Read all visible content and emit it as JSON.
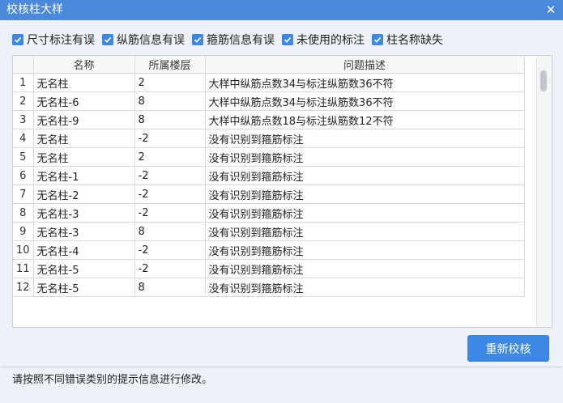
{
  "window": {
    "title": "校核柱大样",
    "close_icon": "close-icon"
  },
  "filters": [
    {
      "label": "尺寸标注有误",
      "checked": true
    },
    {
      "label": "纵筋信息有误",
      "checked": true
    },
    {
      "label": "箍筋信息有误",
      "checked": true
    },
    {
      "label": "未使用的标注",
      "checked": true
    },
    {
      "label": "柱名称缺失",
      "checked": true
    }
  ],
  "table": {
    "columns": [
      "",
      "名称",
      "所属楼层",
      "问题描述"
    ],
    "rows": [
      {
        "index": "1",
        "name": "无名柱",
        "floor": "2",
        "description": "大样中纵筋点数34与标注纵筋数36不符"
      },
      {
        "index": "2",
        "name": "无名柱-6",
        "floor": "8",
        "description": "大样中纵筋点数34与标注纵筋数36不符"
      },
      {
        "index": "3",
        "name": "无名柱-9",
        "floor": "8",
        "description": "大样中纵筋点数18与标注纵筋数12不符"
      },
      {
        "index": "4",
        "name": "无名柱",
        "floor": "-2",
        "description": "没有识别到箍筋标注"
      },
      {
        "index": "5",
        "name": "无名柱",
        "floor": "2",
        "description": "没有识别到箍筋标注"
      },
      {
        "index": "6",
        "name": "无名柱-1",
        "floor": "-2",
        "description": "没有识别到箍筋标注"
      },
      {
        "index": "7",
        "name": "无名柱-2",
        "floor": "-2",
        "description": "没有识别到箍筋标注"
      },
      {
        "index": "8",
        "name": "无名柱-3",
        "floor": "-2",
        "description": "没有识别到箍筋标注"
      },
      {
        "index": "9",
        "name": "无名柱-3",
        "floor": "8",
        "description": "没有识别到箍筋标注"
      },
      {
        "index": "10",
        "name": "无名柱-4",
        "floor": "-2",
        "description": "没有识别到箍筋标注"
      },
      {
        "index": "11",
        "name": "无名柱-5",
        "floor": "-2",
        "description": "没有识别到箍筋标注"
      },
      {
        "index": "12",
        "name": "无名柱-5",
        "floor": "8",
        "description": "没有识别到箍筋标注"
      }
    ]
  },
  "actions": {
    "recheck_label": "重新校核"
  },
  "footer": {
    "hint": "请按照不同错误类别的提示信息进行修改。"
  },
  "colors": {
    "title_bar": "#4a89dc",
    "accent": "#3c88e6",
    "background": "#eef1f7"
  }
}
